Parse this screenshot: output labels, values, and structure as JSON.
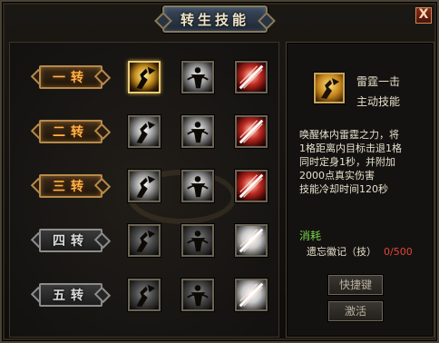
{
  "window": {
    "title": "转生技能",
    "close_label": "X"
  },
  "tiers": [
    {
      "label": "一转",
      "style": "gold",
      "skills": [
        {
          "icon": "thunder-strike-icon",
          "theme": "gold",
          "selected": true
        },
        {
          "icon": "spin-stance-icon",
          "theme": "silver",
          "selected": false
        },
        {
          "icon": "slash-burst-icon",
          "theme": "red",
          "selected": false
        }
      ]
    },
    {
      "label": "二转",
      "style": "gold",
      "skills": [
        {
          "icon": "thunder-strike-icon",
          "theme": "silver",
          "selected": false
        },
        {
          "icon": "spin-stance-icon",
          "theme": "silver",
          "selected": false
        },
        {
          "icon": "slash-burst-icon",
          "theme": "red",
          "selected": false
        }
      ]
    },
    {
      "label": "三转",
      "style": "gold",
      "skills": [
        {
          "icon": "thunder-strike-icon",
          "theme": "silver",
          "selected": false
        },
        {
          "icon": "spin-stance-icon",
          "theme": "silver",
          "selected": false
        },
        {
          "icon": "slash-burst-icon",
          "theme": "red",
          "selected": false
        }
      ]
    },
    {
      "label": "四转",
      "style": "silver",
      "skills": [
        {
          "icon": "thunder-strike-icon",
          "theme": "dark",
          "selected": false
        },
        {
          "icon": "spin-stance-icon",
          "theme": "dark",
          "selected": false
        },
        {
          "icon": "slash-burst-icon",
          "theme": "white",
          "selected": false
        }
      ]
    },
    {
      "label": "五转",
      "style": "silver",
      "skills": [
        {
          "icon": "thunder-strike-icon",
          "theme": "dark",
          "selected": false
        },
        {
          "icon": "spin-stance-icon",
          "theme": "dark",
          "selected": false
        },
        {
          "icon": "slash-burst-icon",
          "theme": "white",
          "selected": false
        }
      ]
    }
  ],
  "detail": {
    "name": "雷霆一击",
    "type": "主动技能",
    "description_lines": [
      "唤醒体内雷霆之力，将",
      "1格距离内目标击退1格",
      "同时定身1秒，并附加",
      "2000点真实伤害",
      "技能冷却时间120秒"
    ],
    "cost_label": "消耗",
    "cost_item": "遗忘徽记（技）",
    "cost_count": "0/500",
    "hotkey_label": "快捷键",
    "activate_label": "激活"
  },
  "colors": {
    "accent_gold": "#ffb24a",
    "cost_green": "#78d24a",
    "cost_red": "#e0463a",
    "text": "#e6dfcc"
  }
}
